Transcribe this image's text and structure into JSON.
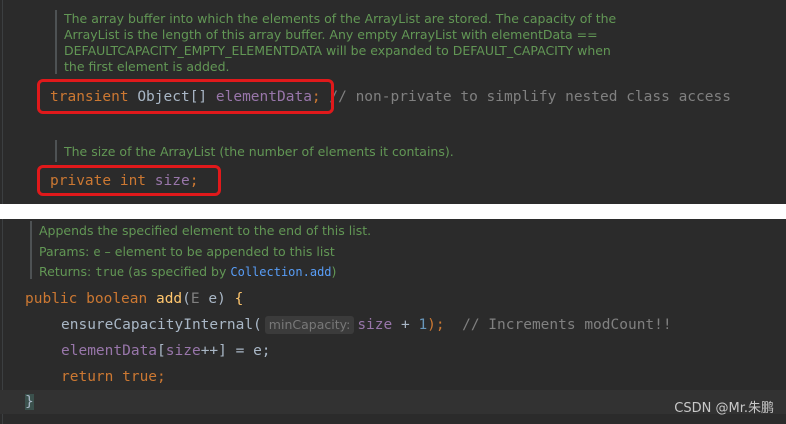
{
  "top": {
    "doc_lines": [
      "The array buffer into which the elements of the ArrayList are stored. The capacity of the",
      "ArrayList is the length of this array buffer. Any empty ArrayList with elementData ==",
      "DEFAULTCAPACITY_EMPTY_ELEMENTDATA will be expanded to DEFAULT_CAPACITY when",
      "the first element is added."
    ],
    "field1": {
      "mod": "transient",
      "type": "Object[]",
      "name": "elementData",
      "semi": ";",
      "comment": "// non-private to simplify nested class access"
    },
    "doc2": "The size of the ArrayList (the number of elements it contains).",
    "field2": {
      "mod": "private",
      "type": "int",
      "name": "size",
      "semi": ";"
    }
  },
  "bottom": {
    "doc_line1": "Appends the specified element to the end of this list.",
    "doc_params_label": "Params:",
    "doc_params_code": "e",
    "doc_params_rest": " – element to be appended to this list",
    "doc_returns_label": "Returns:",
    "doc_returns_code": "true",
    "doc_returns_mid": " (as specified by ",
    "doc_returns_link": "Collection.add",
    "doc_returns_end": ")",
    "sig": {
      "mod": "public",
      "type": "boolean",
      "name": "add",
      "open": "(",
      "ptype": "E",
      "pname": " e",
      "close": ") ",
      "brace": "{"
    },
    "line1": {
      "call": "ensureCapacityInternal(",
      "hint": "minCapacity:",
      "arg": "size",
      "op": " + ",
      "num": "1",
      "end": ");",
      "comment": "// Increments modCount!!"
    },
    "line2": {
      "field": "elementData",
      "open": "[",
      "idx": "size",
      "rest": "++] = e;"
    },
    "line3": {
      "kw": "return",
      "val": " true;"
    },
    "close_brace": "}"
  },
  "watermark": "CSDN @Mr.朱鹏",
  "colors": {
    "background": "#2b2b2b",
    "keyword": "#cc7832",
    "field": "#9876aa",
    "doc": "#629755",
    "comment": "#808080",
    "highlight_box": "#e0191b"
  }
}
